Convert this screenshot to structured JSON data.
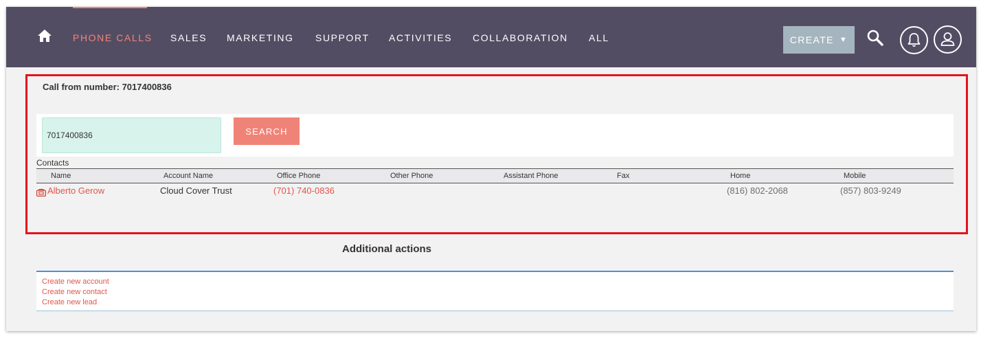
{
  "nav": {
    "items": [
      {
        "label": "PHONE CALLS",
        "active": true
      },
      {
        "label": "SALES"
      },
      {
        "label": "MARKETING"
      },
      {
        "label": "SUPPORT"
      },
      {
        "label": "ACTIVITIES"
      },
      {
        "label": "COLLABORATION"
      },
      {
        "label": "ALL"
      }
    ],
    "create_label": "CREATE",
    "create_caret": "▼"
  },
  "call": {
    "from_label": "Call from number: 7017400836"
  },
  "search": {
    "input_value": "7017400836",
    "button_label": "SEARCH"
  },
  "contacts": {
    "title": "Contacts",
    "columns": [
      "Name",
      "Account Name",
      "Office Phone",
      "Other Phone",
      "Assistant Phone",
      "Fax",
      "Home",
      "Mobile"
    ],
    "rows": [
      {
        "name": "Alberto Gerow",
        "account_name": "Cloud Cover Trust",
        "office_phone": "(701) 740-0836",
        "other_phone": "",
        "assistant_phone": "",
        "fax": "",
        "home": "(816) 802-2068",
        "mobile": "(857) 803-9249"
      }
    ]
  },
  "additional": {
    "title": "Additional actions",
    "links": [
      "Create new account",
      "Create new contact",
      "Create new lead"
    ]
  },
  "colors": {
    "nav_bg": "#534d64",
    "accent": "#f08377",
    "link": "#e4544a",
    "highlight": "#e4121c",
    "input_bg": "#d8f3ec"
  },
  "icons": [
    "home-icon",
    "search-icon",
    "bell-icon",
    "user-icon",
    "phone-icon",
    "chevron-down-icon"
  ]
}
